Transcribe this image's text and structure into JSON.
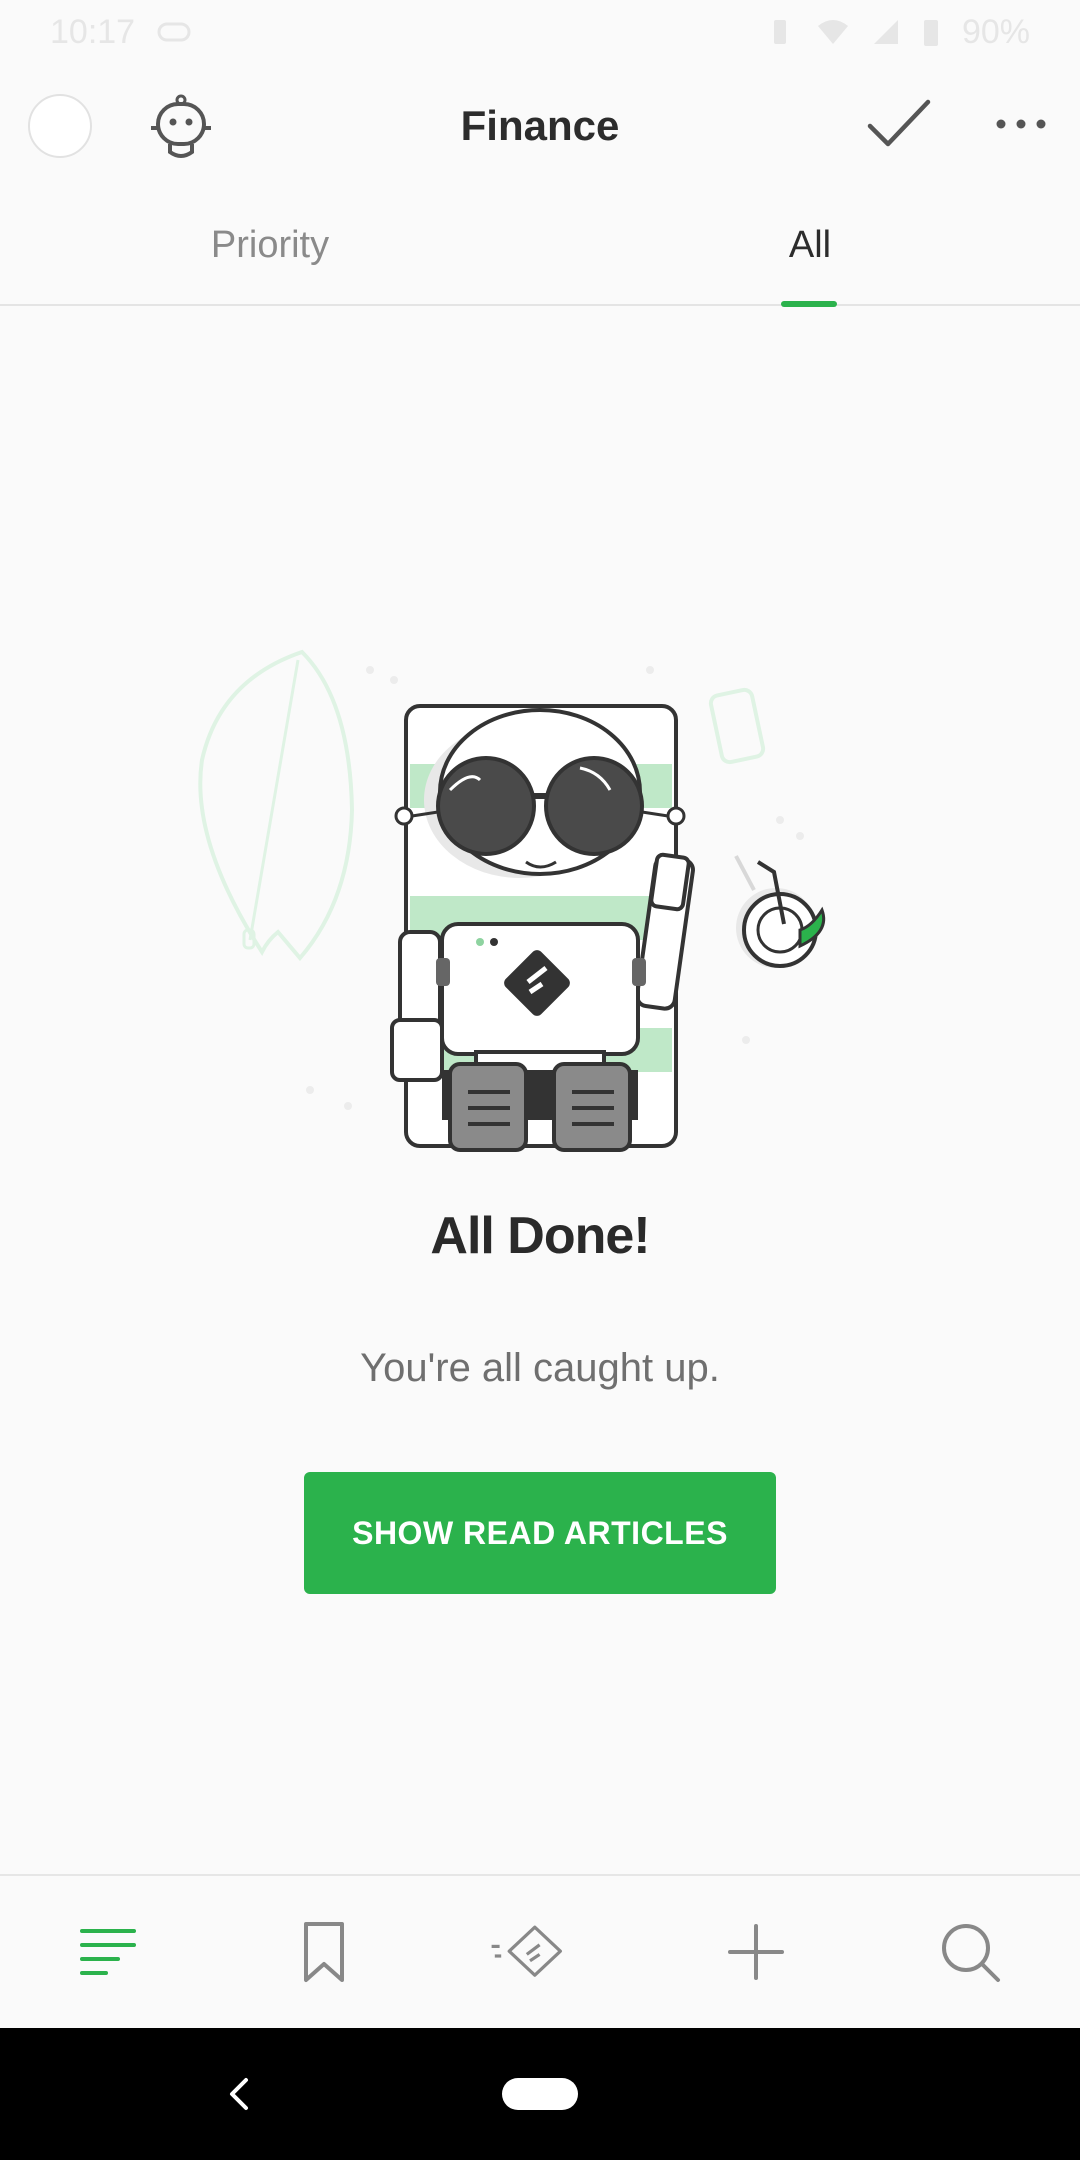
{
  "status_bar": {
    "time": "10:17",
    "battery": "90%"
  },
  "app_bar": {
    "title": "Finance"
  },
  "tabs": [
    {
      "label": "Priority",
      "selected": false
    },
    {
      "label": "All",
      "selected": true
    }
  ],
  "empty_state": {
    "title": "All Done!",
    "subtitle": "You're all caught up.",
    "button_label": "SHOW READ ARTICLES"
  },
  "bottom_nav": {
    "items": [
      {
        "icon": "feed-list-icon",
        "active": true
      },
      {
        "icon": "bookmark-icon",
        "active": false
      },
      {
        "icon": "feedly-logo-icon",
        "active": false
      },
      {
        "icon": "plus-icon",
        "active": false
      },
      {
        "icon": "search-icon",
        "active": false
      }
    ]
  },
  "colors": {
    "accent": "#2bb24c",
    "text": "#2c2c2c",
    "muted": "#8a8a8a"
  }
}
